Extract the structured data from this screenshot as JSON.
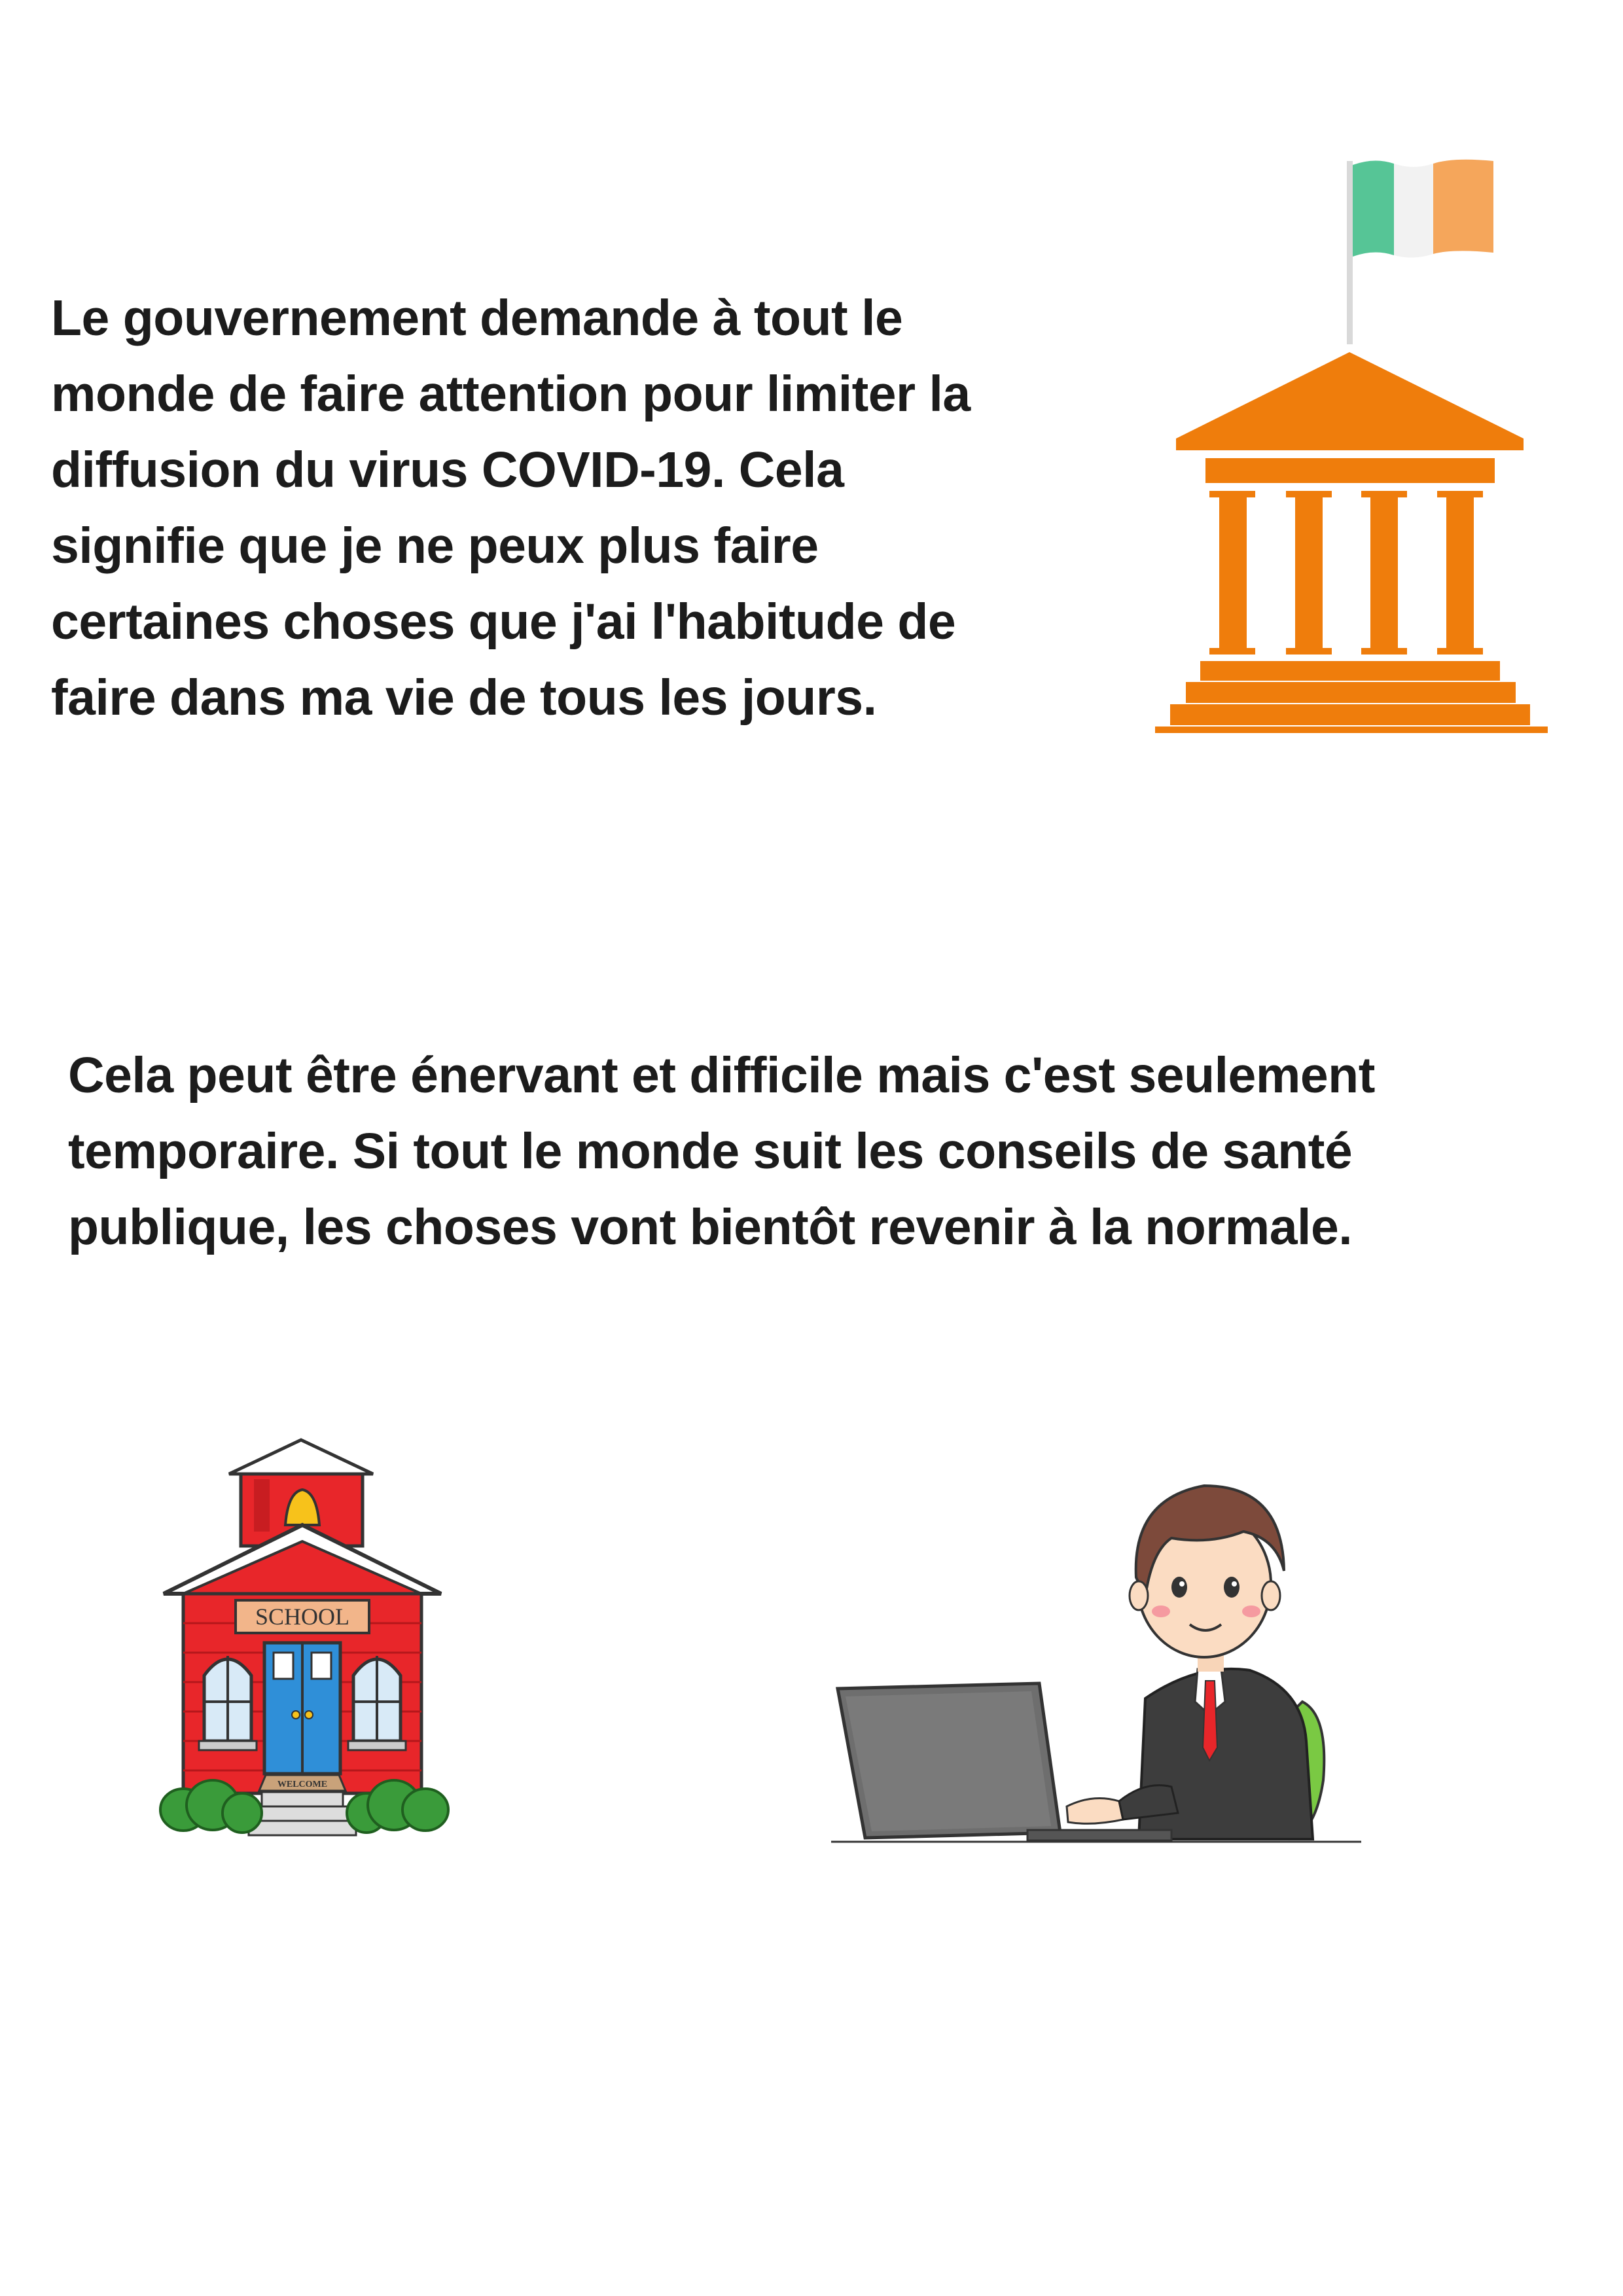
{
  "paragraphs": [
    {
      "lines": [
        "Le gouvernement demande à tout le",
        "monde de faire attention pour limiter la",
        "diffusion du virus COVID-19. Cela",
        "signifie que je ne peux plus faire",
        "certaines choses que j'ai l'habitude de",
        "faire dans ma vie de tous les jours."
      ]
    },
    {
      "lines": [
        "Cela peut être énervant et difficile mais c'est seulement",
        "temporaire. Si tout le monde suit les conseils de santé",
        "publique, les choses vont bientôt revenir à la normale."
      ]
    }
  ],
  "illustrations": {
    "government_building": {
      "icon": "government-building-icon",
      "flag_colors": [
        "#56c596",
        "#f2f2f2",
        "#f5a65b"
      ],
      "building_color": "#ef7d0c"
    },
    "school": {
      "icon": "school-building-icon",
      "sign_text": "SCHOOL",
      "mat_text": "WELCOME",
      "wall_color": "#e8262a",
      "door_color": "#2f8fd8"
    },
    "man_at_laptop": {
      "icon": "man-at-laptop-icon",
      "laptop_color": "#6e6e6e",
      "chair_color": "#7ac943"
    }
  }
}
